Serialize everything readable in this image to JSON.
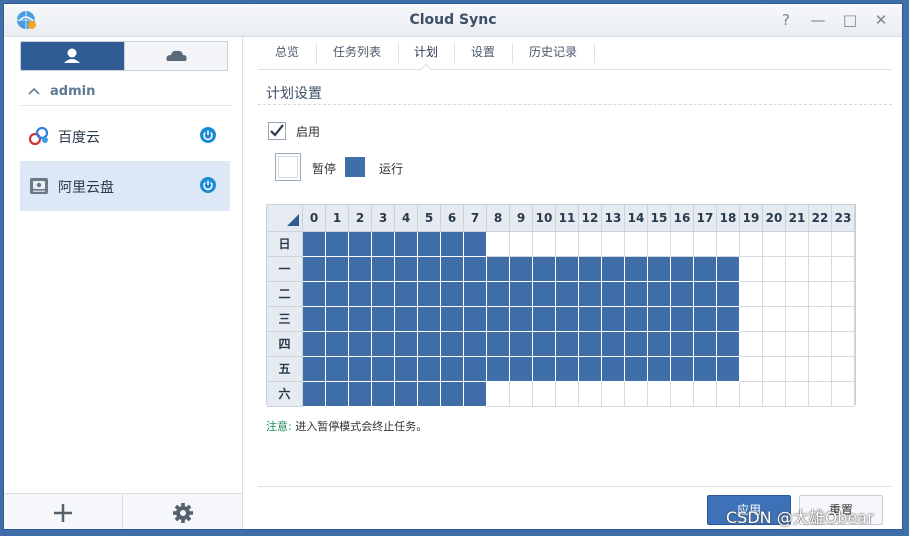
{
  "window": {
    "title": "Cloud Sync",
    "controls": [
      "?",
      "—",
      "□",
      "✕"
    ]
  },
  "sidebar": {
    "segments": [
      {
        "icon": "user-icon"
      },
      {
        "icon": "cloud-icon"
      }
    ],
    "group": "admin",
    "accounts": [
      {
        "name": "百度云",
        "icon": "baidu-cloud-icon",
        "selected": false
      },
      {
        "name": "阿里云盘",
        "icon": "aliyun-drive-icon",
        "selected": true
      }
    ],
    "footer": [
      {
        "icon": "plus-icon"
      },
      {
        "icon": "gear-icon"
      }
    ]
  },
  "tabs": [
    "总览",
    "任务列表",
    "计划",
    "设置",
    "历史记录"
  ],
  "active_tab": "计划",
  "section_title": "计划设置",
  "enable": {
    "label": "启用",
    "checked": true
  },
  "legend": {
    "pause": "暂停",
    "run": "运行",
    "run_color": "#3f6ea8"
  },
  "schedule": {
    "hours": [
      "0",
      "1",
      "2",
      "3",
      "4",
      "5",
      "6",
      "7",
      "8",
      "9",
      "10",
      "11",
      "12",
      "13",
      "14",
      "15",
      "16",
      "17",
      "18",
      "19",
      "20",
      "21",
      "22",
      "23"
    ],
    "days": [
      "日",
      "一",
      "二",
      "三",
      "四",
      "五",
      "六"
    ],
    "active_hours_per_day": [
      8,
      19,
      19,
      19,
      19,
      19,
      8
    ]
  },
  "note": {
    "prefix": "注意:",
    "text": " 进入暂停模式会终止任务。"
  },
  "buttons": {
    "apply": "应用",
    "reset": "重置"
  },
  "watermark": "CSDN @大雄Obear"
}
